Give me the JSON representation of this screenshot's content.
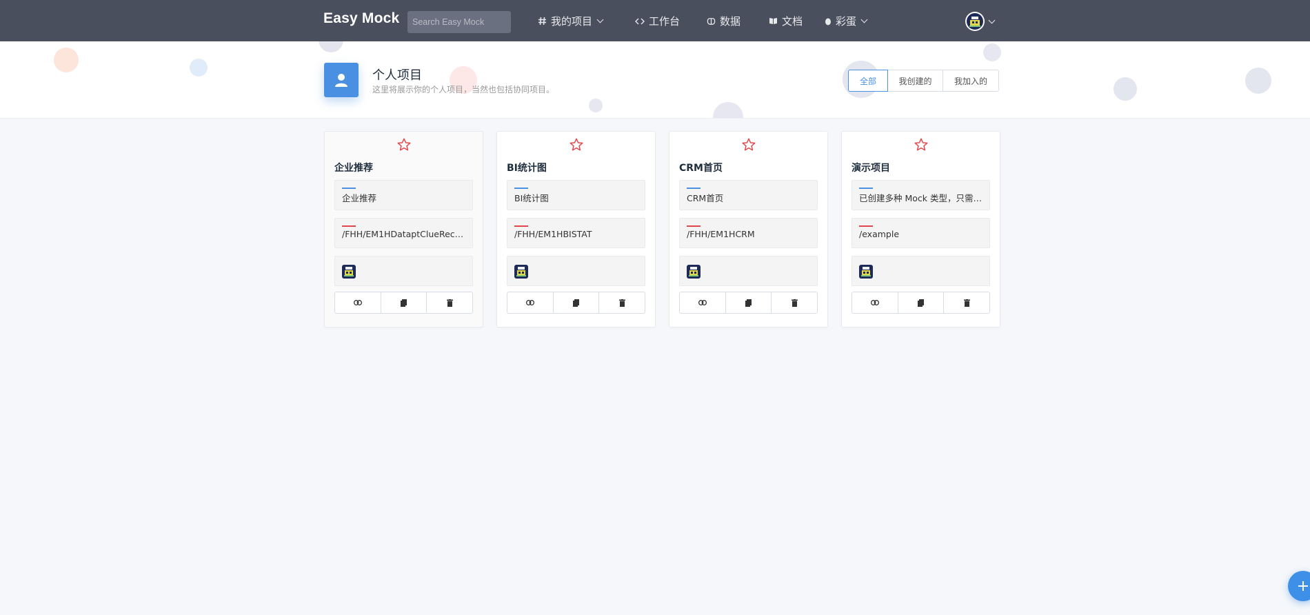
{
  "nav": {
    "brand": "Easy Mock",
    "search_placeholder": "Search Easy Mock",
    "items": [
      {
        "label": "我的项目",
        "icon": "hash-icon"
      },
      {
        "label": "工作台",
        "icon": "code-icon"
      },
      {
        "label": "数据",
        "icon": "brain-icon"
      },
      {
        "label": "文档",
        "icon": "book-icon"
      },
      {
        "label": "彩蛋",
        "icon": "egg-icon"
      }
    ]
  },
  "header": {
    "title": "个人项目",
    "subtitle": "这里将展示你的个人项目，当然也包括协同项目。",
    "filters": [
      "全部",
      "我创建的",
      "我加入的"
    ],
    "active_filter": "全部"
  },
  "projects": [
    {
      "title": "企业推荐",
      "description": "企业推荐",
      "url": "/FHH/EM1HDataptClueRecom..."
    },
    {
      "title": "BI统计图",
      "description": "BI统计图",
      "url": "/FHH/EM1HBISTAT"
    },
    {
      "title": "CRM首页",
      "description": "CRM首页",
      "url": "/FHH/EM1HCRM"
    },
    {
      "title": "演示项目",
      "description": "已创建多种 Mock 类型，只需点...",
      "url": "/example"
    }
  ],
  "colors": {
    "nav_bg": "#4a4f5e",
    "accent": "#4a90e2",
    "star": "#e2454a",
    "desc_bar": "#4a90e2",
    "url_bar": "#e2454a"
  }
}
